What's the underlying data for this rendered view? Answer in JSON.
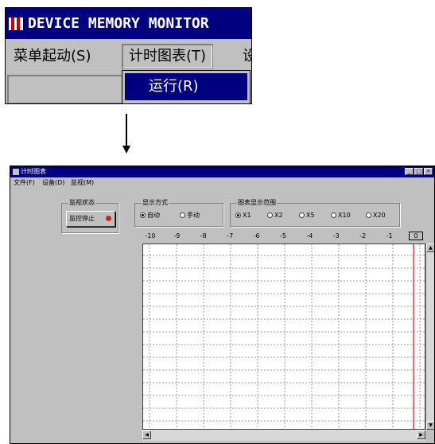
{
  "top_window": {
    "title": "DEVICE MEMORY MONITOR",
    "menu": [
      {
        "label": "菜单起动(S)"
      },
      {
        "label": "计时图表(T)"
      },
      {
        "label": "设"
      }
    ],
    "dropdown_item": "运行(R)"
  },
  "chart_window": {
    "title": "计时图表",
    "menu": [
      "文件(F)",
      "设备(D)",
      "监视(M)"
    ],
    "monitor_group": {
      "label": "监视状态",
      "button_label": "监控停止"
    },
    "display_group": {
      "label": "显示方式",
      "options": [
        "自动",
        "手动"
      ],
      "selected": 0
    },
    "scale_group": {
      "label": "图表显示范围",
      "options": [
        "X1",
        "X2",
        "X5",
        "X10",
        "X20"
      ],
      "selected": 0
    },
    "time_ticks": [
      "-10",
      "-9",
      "-8",
      "-7",
      "-6",
      "-5",
      "-4",
      "-3",
      "-2",
      "-1",
      "0"
    ],
    "colors": {
      "cursor_line": "#e04040",
      "grid": "#9a9a9a",
      "title_bar": "#000080"
    }
  }
}
